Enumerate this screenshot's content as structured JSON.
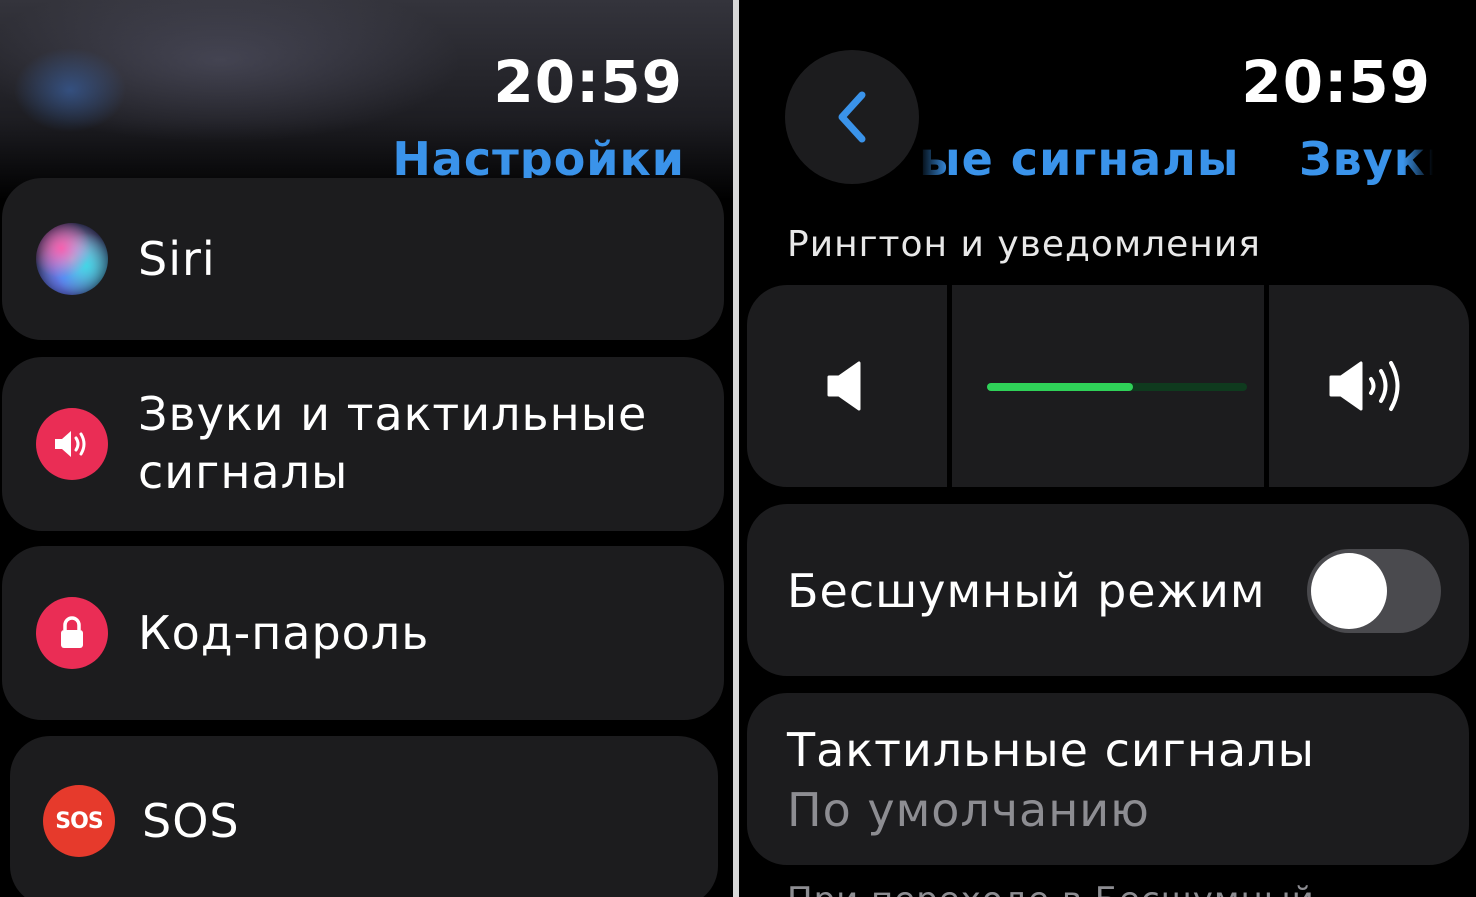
{
  "left_screen": {
    "time": "20:59",
    "title": "Настройки",
    "items": [
      {
        "label": "Siri",
        "icon": "siri-icon"
      },
      {
        "label": "Звуки и тактильные",
        "label_line2": "сигналы",
        "icon": "speaker-icon"
      },
      {
        "label": "Код-пароль",
        "icon": "lock-icon"
      },
      {
        "label": "SOS",
        "icon": "sos-icon",
        "icon_text": "SOS"
      }
    ]
  },
  "right_screen": {
    "time": "20:59",
    "title_fragment_left": "ые сигналы",
    "title_fragment_right": "Звуки",
    "section_header": "Рингтон и уведомления",
    "volume": {
      "level_fraction": 0.56,
      "decrease_icon": "volume-low-icon",
      "increase_icon": "volume-high-icon"
    },
    "silent_mode": {
      "label": "Бесшумный режим",
      "enabled": false
    },
    "haptics": {
      "label": "Тактильные сигналы",
      "value": "По умолчанию"
    },
    "footnote": "При переходе в Бесшумный"
  },
  "colors": {
    "accent_blue": "#3a93ea",
    "card_background": "#1c1c1e",
    "volume_green": "#2fd158",
    "icon_red": "#ea2d55",
    "sos_red": "#e63a2c"
  }
}
